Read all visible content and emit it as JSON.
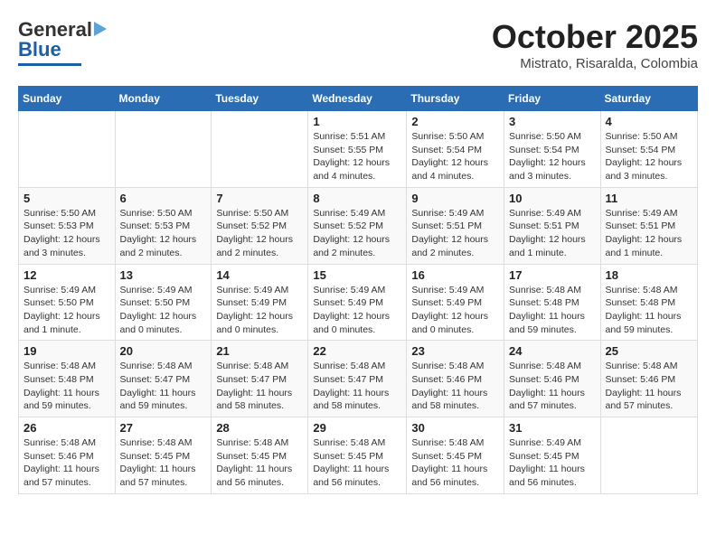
{
  "header": {
    "logo_line1": "General",
    "logo_line2": "Blue",
    "month": "October 2025",
    "location": "Mistrato, Risaralda, Colombia"
  },
  "days_of_week": [
    "Sunday",
    "Monday",
    "Tuesday",
    "Wednesday",
    "Thursday",
    "Friday",
    "Saturday"
  ],
  "weeks": [
    [
      {
        "day": "",
        "info": ""
      },
      {
        "day": "",
        "info": ""
      },
      {
        "day": "",
        "info": ""
      },
      {
        "day": "1",
        "info": "Sunrise: 5:51 AM\nSunset: 5:55 PM\nDaylight: 12 hours and 4 minutes."
      },
      {
        "day": "2",
        "info": "Sunrise: 5:50 AM\nSunset: 5:54 PM\nDaylight: 12 hours and 4 minutes."
      },
      {
        "day": "3",
        "info": "Sunrise: 5:50 AM\nSunset: 5:54 PM\nDaylight: 12 hours and 3 minutes."
      },
      {
        "day": "4",
        "info": "Sunrise: 5:50 AM\nSunset: 5:54 PM\nDaylight: 12 hours and 3 minutes."
      }
    ],
    [
      {
        "day": "5",
        "info": "Sunrise: 5:50 AM\nSunset: 5:53 PM\nDaylight: 12 hours and 3 minutes."
      },
      {
        "day": "6",
        "info": "Sunrise: 5:50 AM\nSunset: 5:53 PM\nDaylight: 12 hours and 2 minutes."
      },
      {
        "day": "7",
        "info": "Sunrise: 5:50 AM\nSunset: 5:52 PM\nDaylight: 12 hours and 2 minutes."
      },
      {
        "day": "8",
        "info": "Sunrise: 5:49 AM\nSunset: 5:52 PM\nDaylight: 12 hours and 2 minutes."
      },
      {
        "day": "9",
        "info": "Sunrise: 5:49 AM\nSunset: 5:51 PM\nDaylight: 12 hours and 2 minutes."
      },
      {
        "day": "10",
        "info": "Sunrise: 5:49 AM\nSunset: 5:51 PM\nDaylight: 12 hours and 1 minute."
      },
      {
        "day": "11",
        "info": "Sunrise: 5:49 AM\nSunset: 5:51 PM\nDaylight: 12 hours and 1 minute."
      }
    ],
    [
      {
        "day": "12",
        "info": "Sunrise: 5:49 AM\nSunset: 5:50 PM\nDaylight: 12 hours and 1 minute."
      },
      {
        "day": "13",
        "info": "Sunrise: 5:49 AM\nSunset: 5:50 PM\nDaylight: 12 hours and 0 minutes."
      },
      {
        "day": "14",
        "info": "Sunrise: 5:49 AM\nSunset: 5:49 PM\nDaylight: 12 hours and 0 minutes."
      },
      {
        "day": "15",
        "info": "Sunrise: 5:49 AM\nSunset: 5:49 PM\nDaylight: 12 hours and 0 minutes."
      },
      {
        "day": "16",
        "info": "Sunrise: 5:49 AM\nSunset: 5:49 PM\nDaylight: 12 hours and 0 minutes."
      },
      {
        "day": "17",
        "info": "Sunrise: 5:48 AM\nSunset: 5:48 PM\nDaylight: 11 hours and 59 minutes."
      },
      {
        "day": "18",
        "info": "Sunrise: 5:48 AM\nSunset: 5:48 PM\nDaylight: 11 hours and 59 minutes."
      }
    ],
    [
      {
        "day": "19",
        "info": "Sunrise: 5:48 AM\nSunset: 5:48 PM\nDaylight: 11 hours and 59 minutes."
      },
      {
        "day": "20",
        "info": "Sunrise: 5:48 AM\nSunset: 5:47 PM\nDaylight: 11 hours and 59 minutes."
      },
      {
        "day": "21",
        "info": "Sunrise: 5:48 AM\nSunset: 5:47 PM\nDaylight: 11 hours and 58 minutes."
      },
      {
        "day": "22",
        "info": "Sunrise: 5:48 AM\nSunset: 5:47 PM\nDaylight: 11 hours and 58 minutes."
      },
      {
        "day": "23",
        "info": "Sunrise: 5:48 AM\nSunset: 5:46 PM\nDaylight: 11 hours and 58 minutes."
      },
      {
        "day": "24",
        "info": "Sunrise: 5:48 AM\nSunset: 5:46 PM\nDaylight: 11 hours and 57 minutes."
      },
      {
        "day": "25",
        "info": "Sunrise: 5:48 AM\nSunset: 5:46 PM\nDaylight: 11 hours and 57 minutes."
      }
    ],
    [
      {
        "day": "26",
        "info": "Sunrise: 5:48 AM\nSunset: 5:46 PM\nDaylight: 11 hours and 57 minutes."
      },
      {
        "day": "27",
        "info": "Sunrise: 5:48 AM\nSunset: 5:45 PM\nDaylight: 11 hours and 57 minutes."
      },
      {
        "day": "28",
        "info": "Sunrise: 5:48 AM\nSunset: 5:45 PM\nDaylight: 11 hours and 56 minutes."
      },
      {
        "day": "29",
        "info": "Sunrise: 5:48 AM\nSunset: 5:45 PM\nDaylight: 11 hours and 56 minutes."
      },
      {
        "day": "30",
        "info": "Sunrise: 5:48 AM\nSunset: 5:45 PM\nDaylight: 11 hours and 56 minutes."
      },
      {
        "day": "31",
        "info": "Sunrise: 5:49 AM\nSunset: 5:45 PM\nDaylight: 11 hours and 56 minutes."
      },
      {
        "day": "",
        "info": ""
      }
    ]
  ]
}
